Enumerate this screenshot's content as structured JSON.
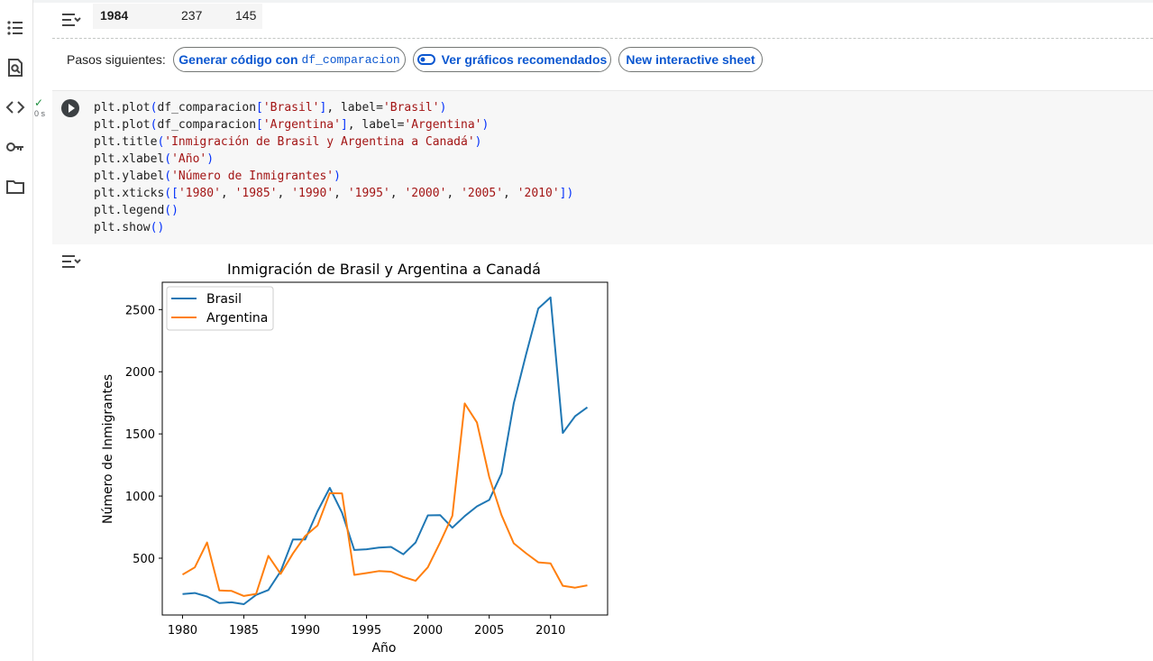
{
  "previous_output": {
    "row": {
      "index": "1984",
      "brasil": "237",
      "argentina": "145"
    }
  },
  "next_steps": {
    "label": "Pasos siguientes:",
    "chip1_prefix": "Generar código con",
    "chip1_code": "df_comparacion",
    "chip2": "Ver gráficos recomendados",
    "chip3": "New interactive sheet"
  },
  "cell": {
    "status_check": "✓",
    "status_time": "0 s",
    "code_lines": [
      "plt.plot(df_comparacion['Brasil'], label='Brasil')",
      "plt.plot(df_comparacion['Argentina'], label='Argentina')",
      "plt.title('Inmigración de Brasil y Argentina a Canadá')",
      "plt.xlabel('Año')",
      "plt.ylabel('Número de Inmigrantes')",
      "plt.xticks(['1980', '1985', '1990', '1995', '2000', '2005', '2010'])",
      "plt.legend()",
      "plt.show()"
    ]
  },
  "colors": {
    "accent": "#0b57d0",
    "brasil": "#1f77b4",
    "argentina": "#ff7f0e"
  },
  "icons": [
    "toc-icon",
    "find-icon",
    "code-snippets-icon",
    "key-icon",
    "folder-icon",
    "output-collapse-icon",
    "run-icon"
  ],
  "chart_data": {
    "type": "line",
    "title": "Inmigración de Brasil y Argentina a Canadá",
    "xlabel": "Año",
    "ylabel": "Número de Inmigrantes",
    "x": [
      1980,
      1981,
      1982,
      1983,
      1984,
      1985,
      1986,
      1987,
      1988,
      1989,
      1990,
      1991,
      1992,
      1993,
      1994,
      1995,
      1996,
      1997,
      1998,
      1999,
      2000,
      2001,
      2002,
      2003,
      2004,
      2005,
      2006,
      2007,
      2008,
      2009,
      2010,
      2011,
      2012,
      2013
    ],
    "xticks": [
      "1980",
      "1985",
      "1990",
      "1995",
      "2000",
      "2005",
      "2010"
    ],
    "yticks": [
      "500",
      "1000",
      "1500",
      "2000",
      "2500"
    ],
    "xlim": [
      1978.35,
      2014.65
    ],
    "ylim": [
      43,
      2720
    ],
    "legend": "top-left",
    "grid": false,
    "series": [
      {
        "name": "Brasil",
        "color": "#1f77b4",
        "values": [
          211,
          220,
          192,
          139,
          145,
          130,
          205,
          244,
          394,
          650,
          650,
          877,
          1066,
          866,
          566,
          572,
          586,
          591,
          531,
          626,
          845,
          847,
          745,
          839,
          917,
          969,
          1181,
          1746,
          2138,
          2509,
          2598,
          1508,
          1642,
          1714
        ]
      },
      {
        "name": "Argentina",
        "color": "#ff7f0e",
        "values": [
          368,
          426,
          626,
          241,
          237,
          196,
          213,
          519,
          374,
          538,
          678,
          763,
          1023,
          1022,
          366,
          380,
          396,
          391,
          349,
          318,
          427,
          626,
          841,
          1745,
          1591,
          1153,
          847,
          620,
          540,
          467,
          459,
          278,
          263,
          282
        ]
      }
    ]
  }
}
